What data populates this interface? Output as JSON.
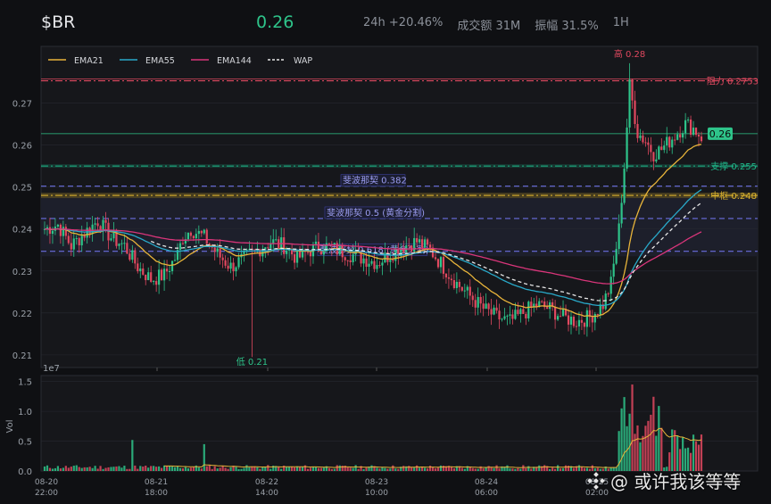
{
  "header": {
    "symbol": "$BR",
    "price": "0.26",
    "change": "24h +20.46%",
    "turnover": "成交额 31M",
    "amplitude": "振幅 31.5%",
    "interval": "1H"
  },
  "colors": {
    "up": "#2ec48a",
    "down": "#e0485f",
    "ema21": "#e8b43a",
    "ema55": "#29a9c9",
    "ema144": "#d9357a",
    "vwap": "#e6e6e6",
    "resist": "#e0485f",
    "support": "#1fb88a",
    "mid": "#d9b12e",
    "fib": "#6b6fe0",
    "bg": "#16171b",
    "grid": "#262830"
  },
  "chart_data": [
    {
      "type": "candlestick",
      "legend": [
        "EMA21",
        "EMA55",
        "EMA144",
        "WAP"
      ],
      "yticks": [
        "0.21",
        "0.22",
        "0.23",
        "0.24",
        "0.25",
        "0.26",
        "0.27"
      ],
      "ylim": [
        0.207,
        0.2835
      ],
      "last_price_label": "0.26",
      "levels": [
        {
          "label": "阻力 0.2753",
          "value": 0.2753,
          "kind": "resist"
        },
        {
          "label": "支撑 0.255",
          "value": 0.255,
          "kind": "support"
        },
        {
          "label": "中枢 0.248",
          "value": 0.248,
          "kind": "mid"
        },
        {
          "label": "斐波那契 0.382",
          "value": 0.2502,
          "kind": "fib"
        },
        {
          "label": "斐波那契 0.5 (黄金分割)",
          "value": 0.2425,
          "kind": "fib"
        },
        {
          "label": "斐波那契 0.618 (黄金分割)",
          "value": 0.2347,
          "kind": "fib"
        }
      ],
      "annotations": {
        "high": "高 0.28",
        "low": "低 0.21"
      },
      "xticks_top": [
        "1e7",
        "08-2",
        "08-21",
        "08-22",
        "08-23",
        "08-24",
        "08-25"
      ],
      "price_waypoints": [
        [
          0,
          0.24
        ],
        [
          5,
          0.241
        ],
        [
          10,
          0.236
        ],
        [
          15,
          0.239
        ],
        [
          20,
          0.242
        ],
        [
          25,
          0.238
        ],
        [
          30,
          0.236
        ],
        [
          35,
          0.231
        ],
        [
          40,
          0.228
        ],
        [
          45,
          0.229
        ],
        [
          50,
          0.234
        ],
        [
          52,
          0.238
        ],
        [
          55,
          0.24
        ],
        [
          60,
          0.238
        ],
        [
          65,
          0.234
        ],
        [
          70,
          0.231
        ],
        [
          75,
          0.233
        ],
        [
          80,
          0.235
        ],
        [
          85,
          0.237
        ],
        [
          90,
          0.236
        ],
        [
          95,
          0.233
        ],
        [
          100,
          0.235
        ],
        [
          105,
          0.236
        ],
        [
          110,
          0.235
        ],
        [
          115,
          0.234
        ],
        [
          120,
          0.233
        ],
        [
          125,
          0.232
        ],
        [
          130,
          0.234
        ],
        [
          135,
          0.236
        ],
        [
          140,
          0.237
        ],
        [
          145,
          0.235
        ],
        [
          150,
          0.231
        ],
        [
          155,
          0.227
        ],
        [
          160,
          0.224
        ],
        [
          165,
          0.221
        ],
        [
          170,
          0.219
        ],
        [
          175,
          0.218
        ],
        [
          180,
          0.22
        ],
        [
          185,
          0.222
        ],
        [
          190,
          0.221
        ],
        [
          195,
          0.219
        ],
        [
          200,
          0.218
        ],
        [
          205,
          0.219
        ],
        [
          210,
          0.222
        ],
        [
          213,
          0.227
        ],
        [
          216,
          0.24
        ],
        [
          218,
          0.255
        ],
        [
          220,
          0.274
        ],
        [
          223,
          0.263
        ],
        [
          226,
          0.261
        ],
        [
          229,
          0.258
        ],
        [
          232,
          0.259
        ],
        [
          235,
          0.261
        ],
        [
          238,
          0.263
        ],
        [
          241,
          0.265
        ],
        [
          244,
          0.264
        ],
        [
          247,
          0.262
        ]
      ]
    },
    {
      "type": "bar",
      "ylabel": "Vol",
      "yticks": [
        "0.0",
        "0.5",
        "1.0",
        "1.5"
      ],
      "ylim": [
        0,
        1.6
      ],
      "xticks": [
        [
          "08-20",
          "22:00"
        ],
        [
          "08-21",
          "18:00"
        ],
        [
          "08-22",
          "14:00"
        ],
        [
          "08-23",
          "10:00"
        ],
        [
          "08-24",
          "06:00"
        ],
        [
          "08-25",
          "02:00"
        ]
      ]
    }
  ],
  "watermark": "@ 或许我该等等"
}
